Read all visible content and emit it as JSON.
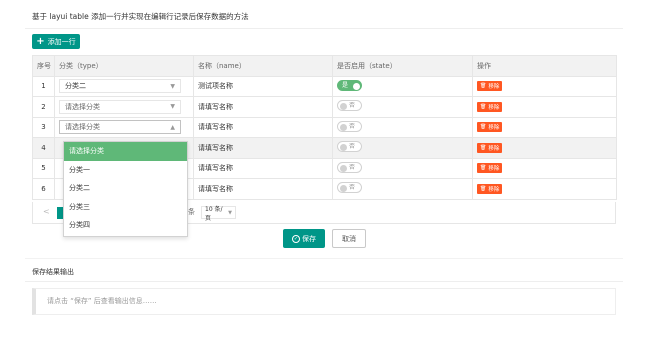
{
  "header": {
    "title": "基于 layui table 添加一行并实现在编辑行记录后保存数据的方法"
  },
  "toolbar": {
    "add_label": "添加一行"
  },
  "table": {
    "columns": [
      "序号",
      "分类（type）",
      "名称（name）",
      "是否启用（state）",
      "操作"
    ],
    "rows": [
      {
        "index": "1",
        "type": "分类二",
        "name": "测试项名称",
        "state_on": true,
        "state_label": "是"
      },
      {
        "index": "2",
        "type": "请选择分类",
        "name": "请填写名称",
        "state_on": false,
        "state_label": "否"
      },
      {
        "index": "3",
        "type": "请选择分类",
        "name": "请填写名称",
        "state_on": false,
        "state_label": "否"
      },
      {
        "index": "4",
        "type": "",
        "name": "请填写名称",
        "state_on": false,
        "state_label": "否"
      },
      {
        "index": "5",
        "type": "",
        "name": "请填写名称",
        "state_on": false,
        "state_label": "否"
      },
      {
        "index": "6",
        "type": "",
        "name": "请填写名称",
        "state_on": false,
        "state_label": "否"
      }
    ],
    "delete_label": "移除"
  },
  "dropdown": {
    "options": [
      "请选择分类",
      "分类一",
      "分类二",
      "分类三",
      "分类四"
    ],
    "selected": "请选择分类"
  },
  "pager": {
    "prev": "<",
    "count_suffix": "条",
    "page_size": "10 条/页"
  },
  "actions": {
    "save_label": "保存",
    "cancel_label": "取消"
  },
  "output": {
    "title": "保存结果输出",
    "placeholder": "请点击 “保存” 后查看输出信息……"
  },
  "colors": {
    "primary": "#009688",
    "switch_on": "#5fb878",
    "danger": "#ff5722"
  }
}
